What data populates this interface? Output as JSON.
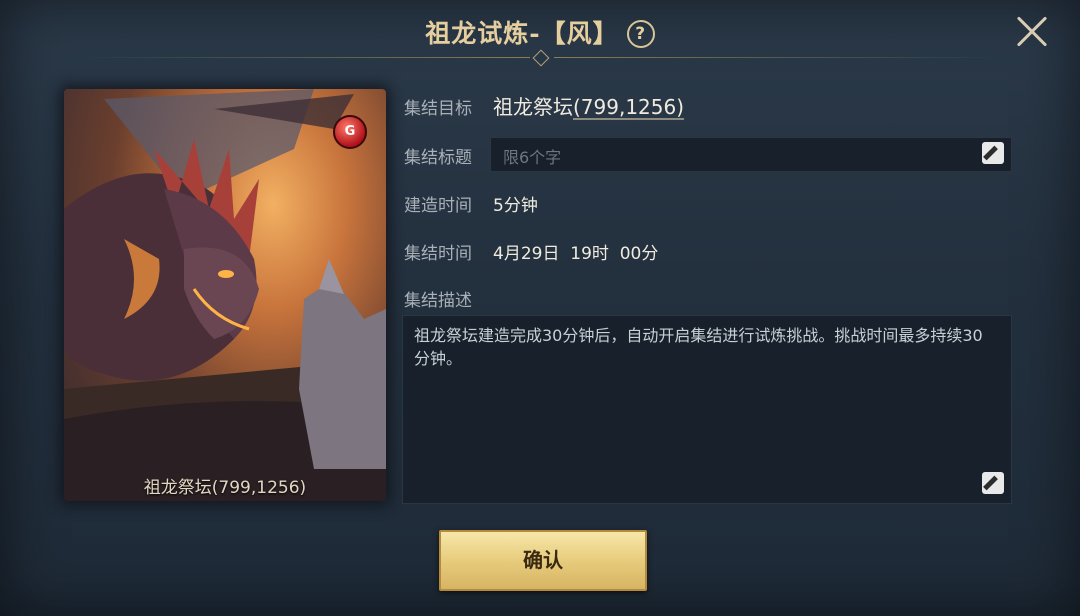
{
  "header": {
    "title": "祖龙试炼-【风】",
    "help_icon": "question-mark-icon",
    "close_icon": "close-icon"
  },
  "card": {
    "label": "祖龙祭坛(799,1256)",
    "badge_icon": "red-dragon-badge-icon"
  },
  "form": {
    "target_label": "集结目标",
    "target_name": "祖龙祭坛",
    "target_coord": "(799,1256)",
    "title_label": "集结标题",
    "title_placeholder": "限6个字",
    "build_label": "建造时间",
    "build_value": "5分钟",
    "rally_time_label": "集结时间",
    "rally_time_value": "4月29日  19时  00分",
    "desc_label": "集结描述",
    "desc_value": "祖龙祭坛建造完成30分钟后，自动开启集结进行试炼挑战。挑战时间最多持续30分钟。",
    "edit_icon": "edit-pencil-icon"
  },
  "actions": {
    "confirm_label": "确认"
  },
  "colors": {
    "panel_bg": "#23303e",
    "title_gold": "#e6cf9e",
    "button_gold": "#e7cc7d"
  }
}
